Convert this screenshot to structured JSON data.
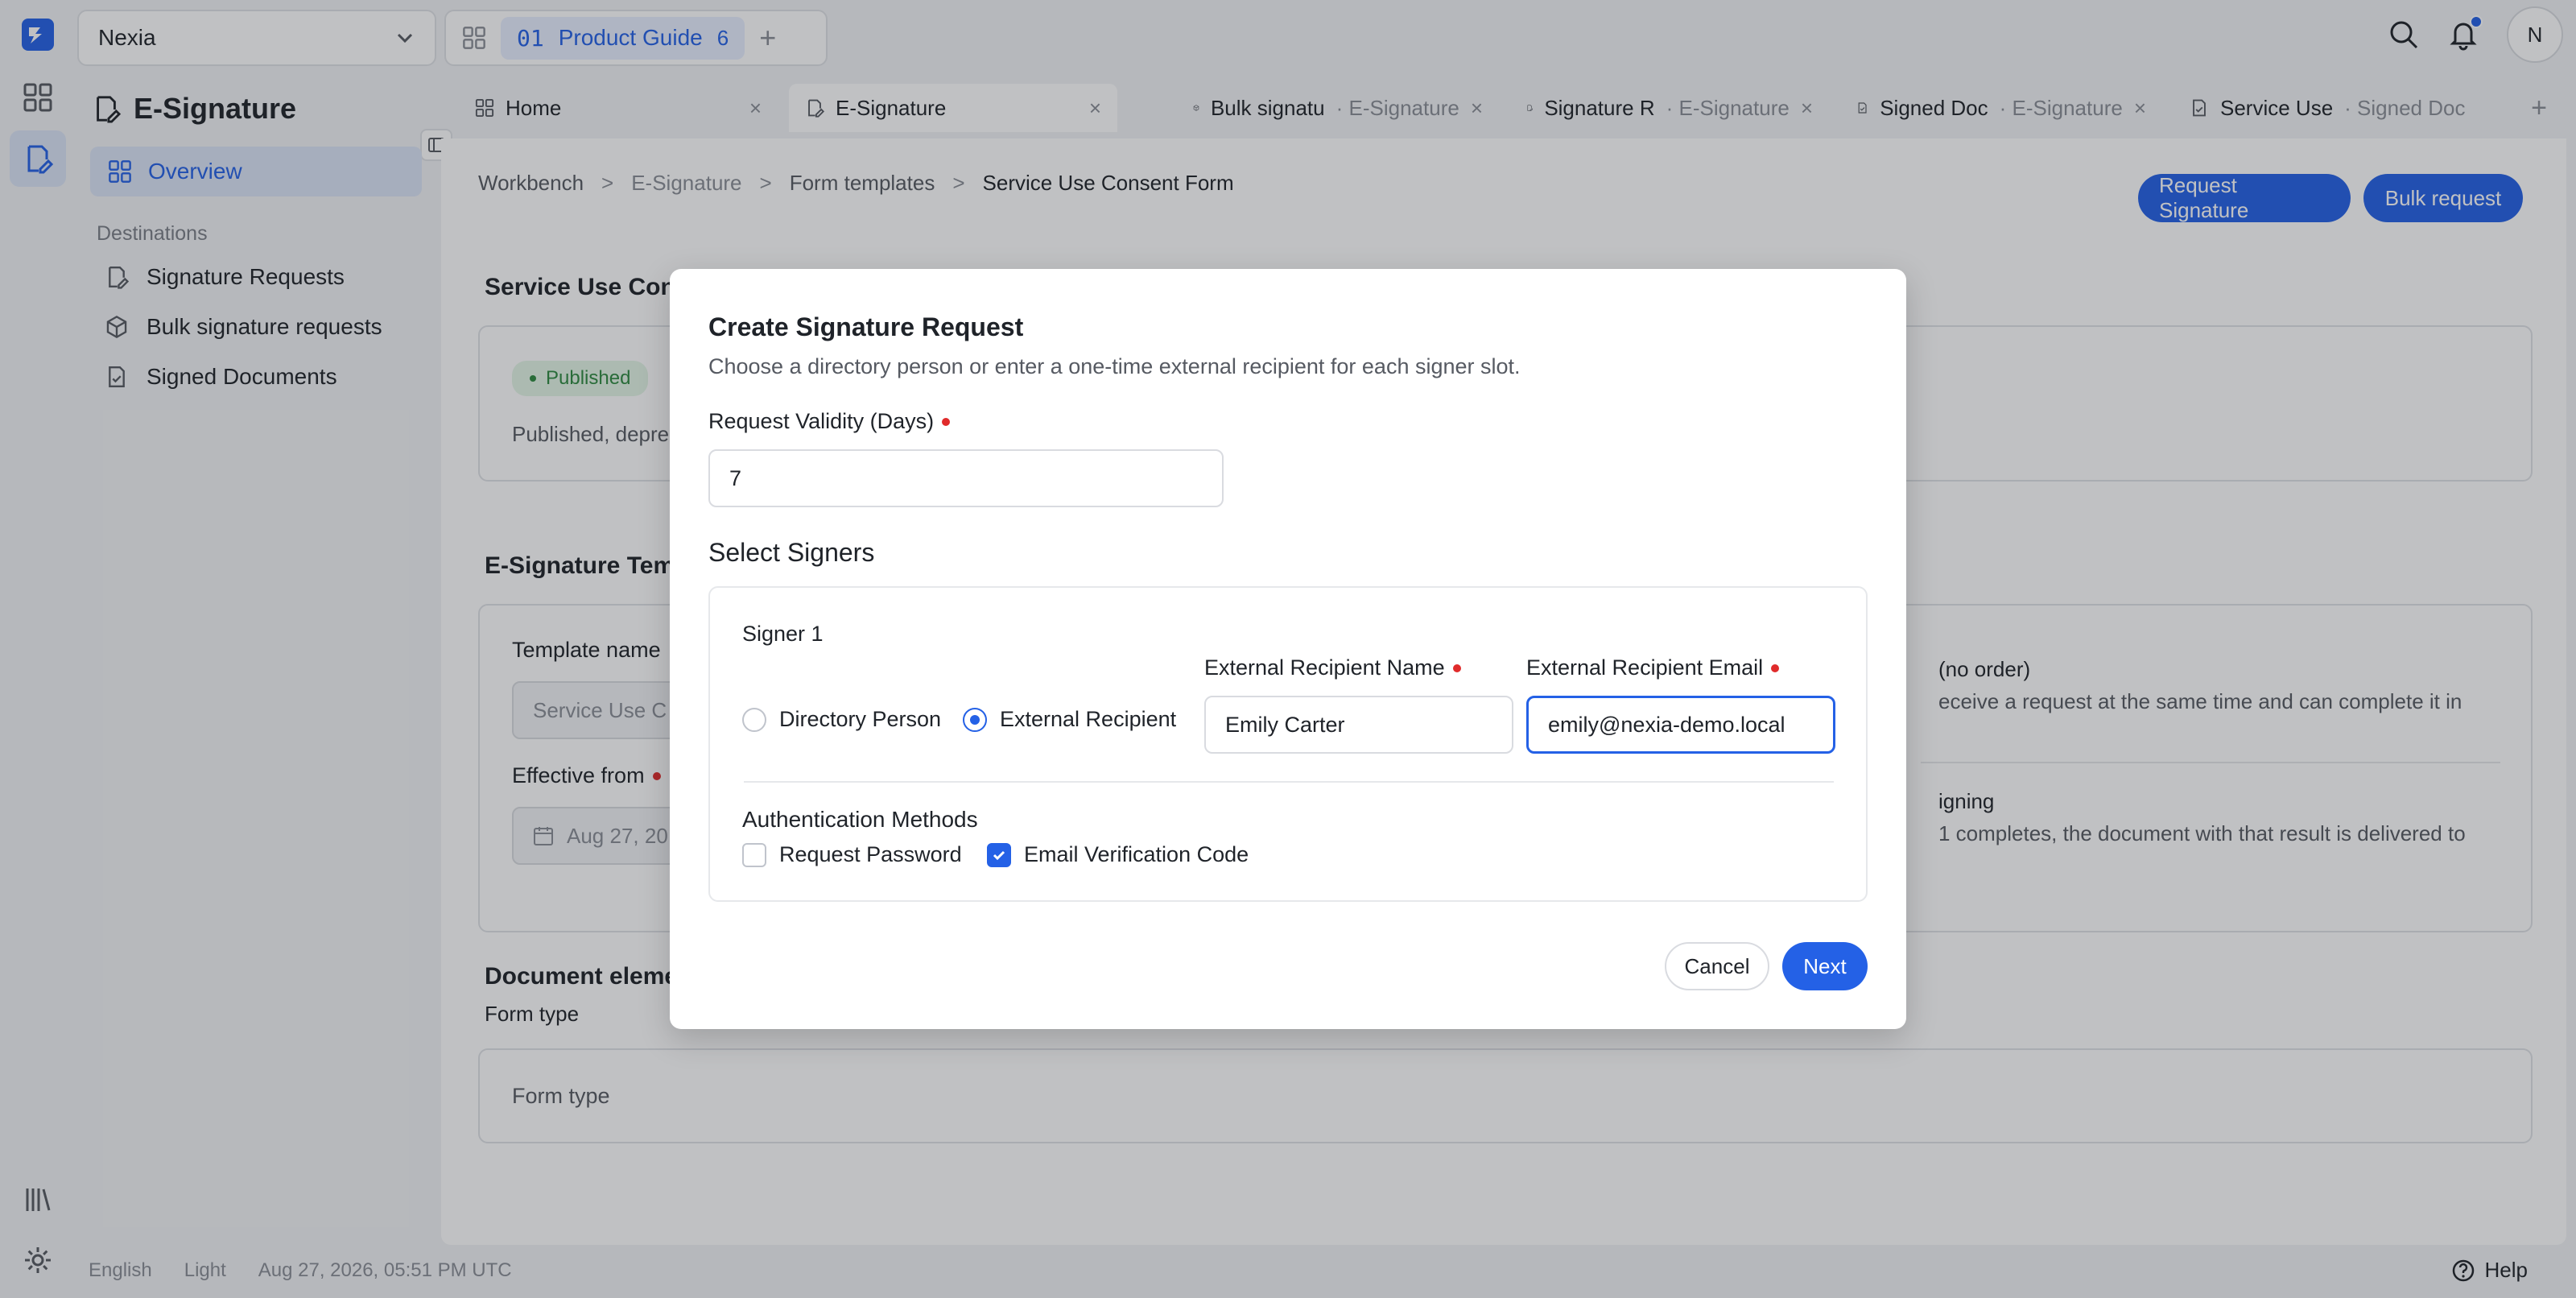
{
  "topbar": {
    "org_name": "Nexia",
    "workspace_prefix": "01",
    "workspace_name": "Product Guide",
    "workspace_count": "6",
    "avatar_initial": "N"
  },
  "sidebar": {
    "app_title": "E-Signature",
    "overview_label": "Overview",
    "destinations_heading": "Destinations",
    "items": [
      {
        "label": "Signature Requests"
      },
      {
        "label": "Bulk signature requests"
      },
      {
        "label": "Signed Documents"
      }
    ]
  },
  "tabs": [
    {
      "title": "Home",
      "sub": ""
    },
    {
      "title": "E-Signature",
      "sub": ""
    },
    {
      "title": "Bulk signatu",
      "sub": "· E-Signature"
    },
    {
      "title": "Signature R",
      "sub": "· E-Signature"
    },
    {
      "title": "Signed Doc",
      "sub": "· E-Signature"
    },
    {
      "title": "Service Use",
      "sub": "· Signed Doc"
    }
  ],
  "breadcrumb": [
    "Workbench",
    "E-Signature",
    "Form templates",
    "Service Use Consent Form"
  ],
  "actions": {
    "request_signature": "Request Signature",
    "bulk_request": "Bulk request"
  },
  "page": {
    "section1_title": "Service Use Con",
    "status_badge": "Published",
    "status_text": "Published, depre",
    "section2_title": "E-Signature Tem",
    "template_name_label": "Template name",
    "template_name_value": "Service Use C",
    "effective_from_label": "Effective from",
    "effective_from_value": "Aug 27, 20",
    "order_title": "(no order)",
    "order_desc": "eceive a request at the same time and can complete it in",
    "signing_title": "igning",
    "signing_desc": "1 completes, the document with that result is delivered to",
    "section3_title": "Document eleme",
    "form_type_label": "Form type",
    "form_type_box": "Form type"
  },
  "footer": {
    "language": "English",
    "theme": "Light",
    "timestamp": "Aug 27, 2026, 05:51 PM UTC",
    "help": "Help"
  },
  "modal": {
    "title": "Create Signature Request",
    "description": "Choose a directory person or enter a one-time external recipient for each signer slot.",
    "validity_label": "Request Validity (Days)",
    "validity_value": "7",
    "select_signers": "Select Signers",
    "signer_title": "Signer 1",
    "option_directory": "Directory Person",
    "option_external": "External Recipient",
    "ext_name_label": "External Recipient Name",
    "ext_name_value": "Emily Carter",
    "ext_email_label": "External Recipient Email",
    "ext_email_value": "emily@nexia-demo.local",
    "auth_title": "Authentication Methods",
    "auth_password": "Request Password",
    "auth_email_code": "Email Verification Code",
    "cancel": "Cancel",
    "next": "Next"
  },
  "colors": {
    "accent": "#2461e6",
    "required": "#e02b2b",
    "published": "#2f8a41"
  }
}
